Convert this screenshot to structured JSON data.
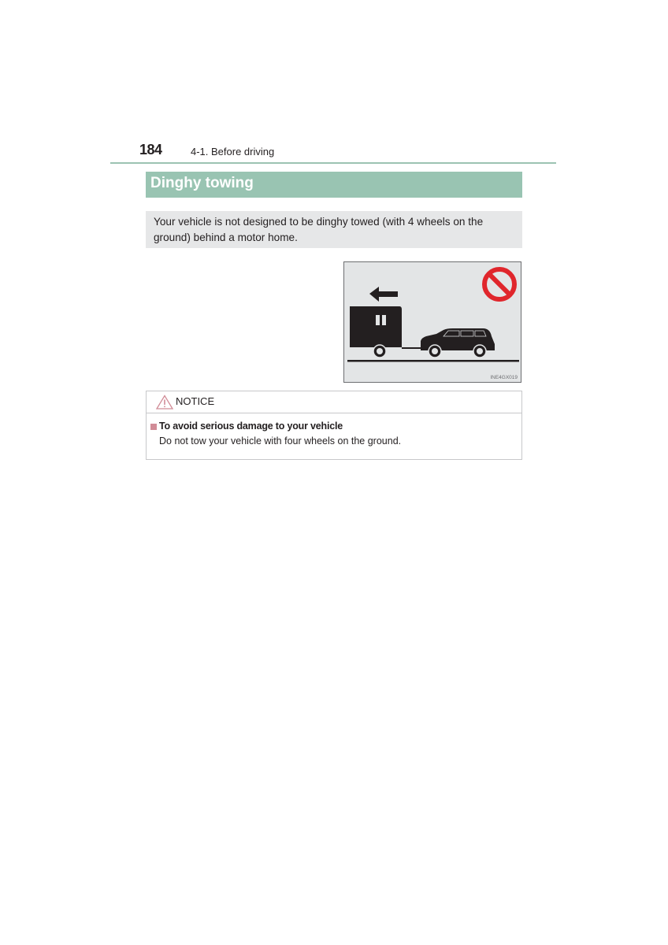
{
  "header": {
    "page_number": "184",
    "section": "4-1. Before driving"
  },
  "section": {
    "title": "Dinghy towing",
    "intro": "Your vehicle is not designed to be dinghy towed (with 4 wheels on the ground) behind a motor home."
  },
  "figure": {
    "code": "INE4GX019",
    "prohibited_color": "#e0262c",
    "icons": [
      "arrow-left-icon",
      "motor-home-icon",
      "suv-icon",
      "prohibited-icon"
    ]
  },
  "notice": {
    "label": "NOTICE",
    "accent_color": "#d18c97",
    "item_title": "To avoid serious damage to your vehicle",
    "item_body": "Do not tow your vehicle with four wheels on the ground."
  }
}
